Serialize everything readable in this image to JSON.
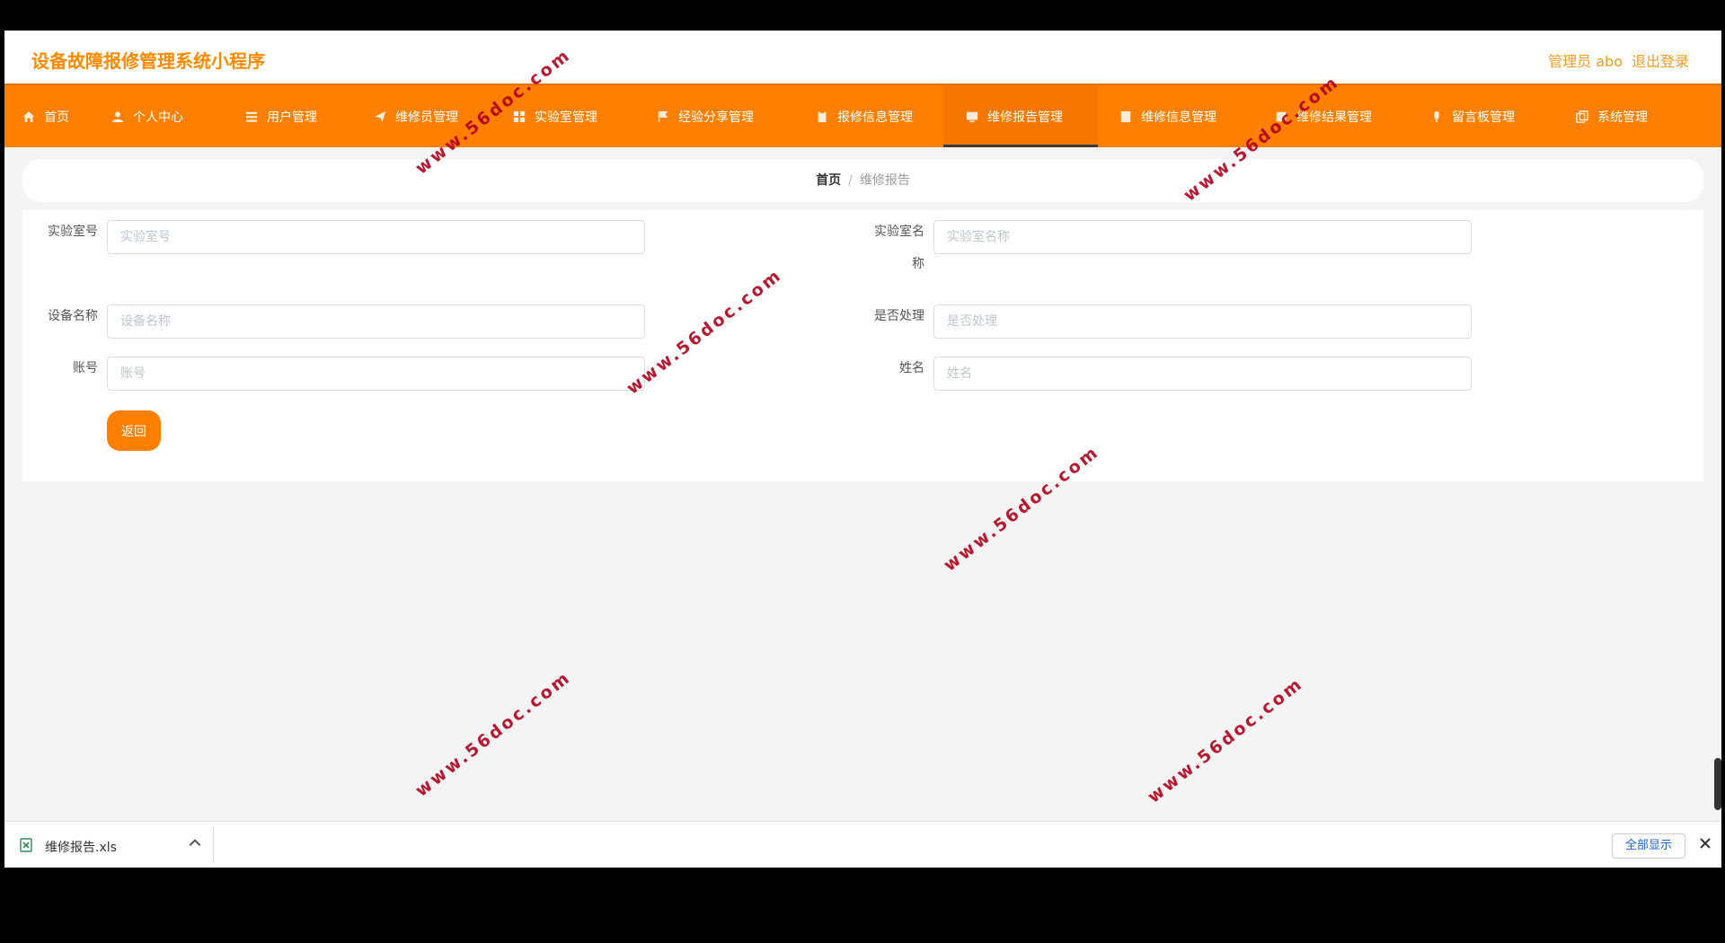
{
  "header": {
    "title": "设备故障报修管理系统小程序",
    "user": "管理员 abo",
    "logout": "退出登录"
  },
  "nav": [
    {
      "label": "首页",
      "icon": "home-icon"
    },
    {
      "label": "个人中心",
      "icon": "user-icon"
    },
    {
      "label": "用户管理",
      "icon": "list-icon"
    },
    {
      "label": "维修员管理",
      "icon": "send-icon"
    },
    {
      "label": "实验室管理",
      "icon": "grid-icon"
    },
    {
      "label": "经验分享管理",
      "icon": "flag-icon"
    },
    {
      "label": "报修信息管理",
      "icon": "clipboard-icon"
    },
    {
      "label": "维修报告管理",
      "icon": "monitor-icon",
      "active": true
    },
    {
      "label": "维修信息管理",
      "icon": "document-icon"
    },
    {
      "label": "维修结果管理",
      "icon": "results-icon"
    },
    {
      "label": "留言板管理",
      "icon": "mic-icon"
    },
    {
      "label": "系统管理",
      "icon": "copy-icon"
    }
  ],
  "breadcrumb": {
    "home": "首页",
    "separator": "/",
    "current": "维修报告"
  },
  "form": {
    "lab_no": {
      "label": "实验室号",
      "placeholder": "实验室号"
    },
    "lab_name": {
      "label_line1": "实验室名",
      "label_line2": "称",
      "placeholder": "实验室名称"
    },
    "device_name": {
      "label": "设备名称",
      "placeholder": "设备名称"
    },
    "processed": {
      "label": "是否处理",
      "placeholder": "是否处理"
    },
    "account": {
      "label": "账号",
      "placeholder": "账号"
    },
    "name": {
      "label": "姓名",
      "placeholder": "姓名"
    },
    "back_button": "返回"
  },
  "watermark": "www.56doc.com",
  "download_bar": {
    "file_name": "维修报告.xls",
    "show_all": "全部显示"
  },
  "colors": {
    "accent": "#ff7f00",
    "title": "#ff8a00",
    "watermark": "#b3001b"
  }
}
